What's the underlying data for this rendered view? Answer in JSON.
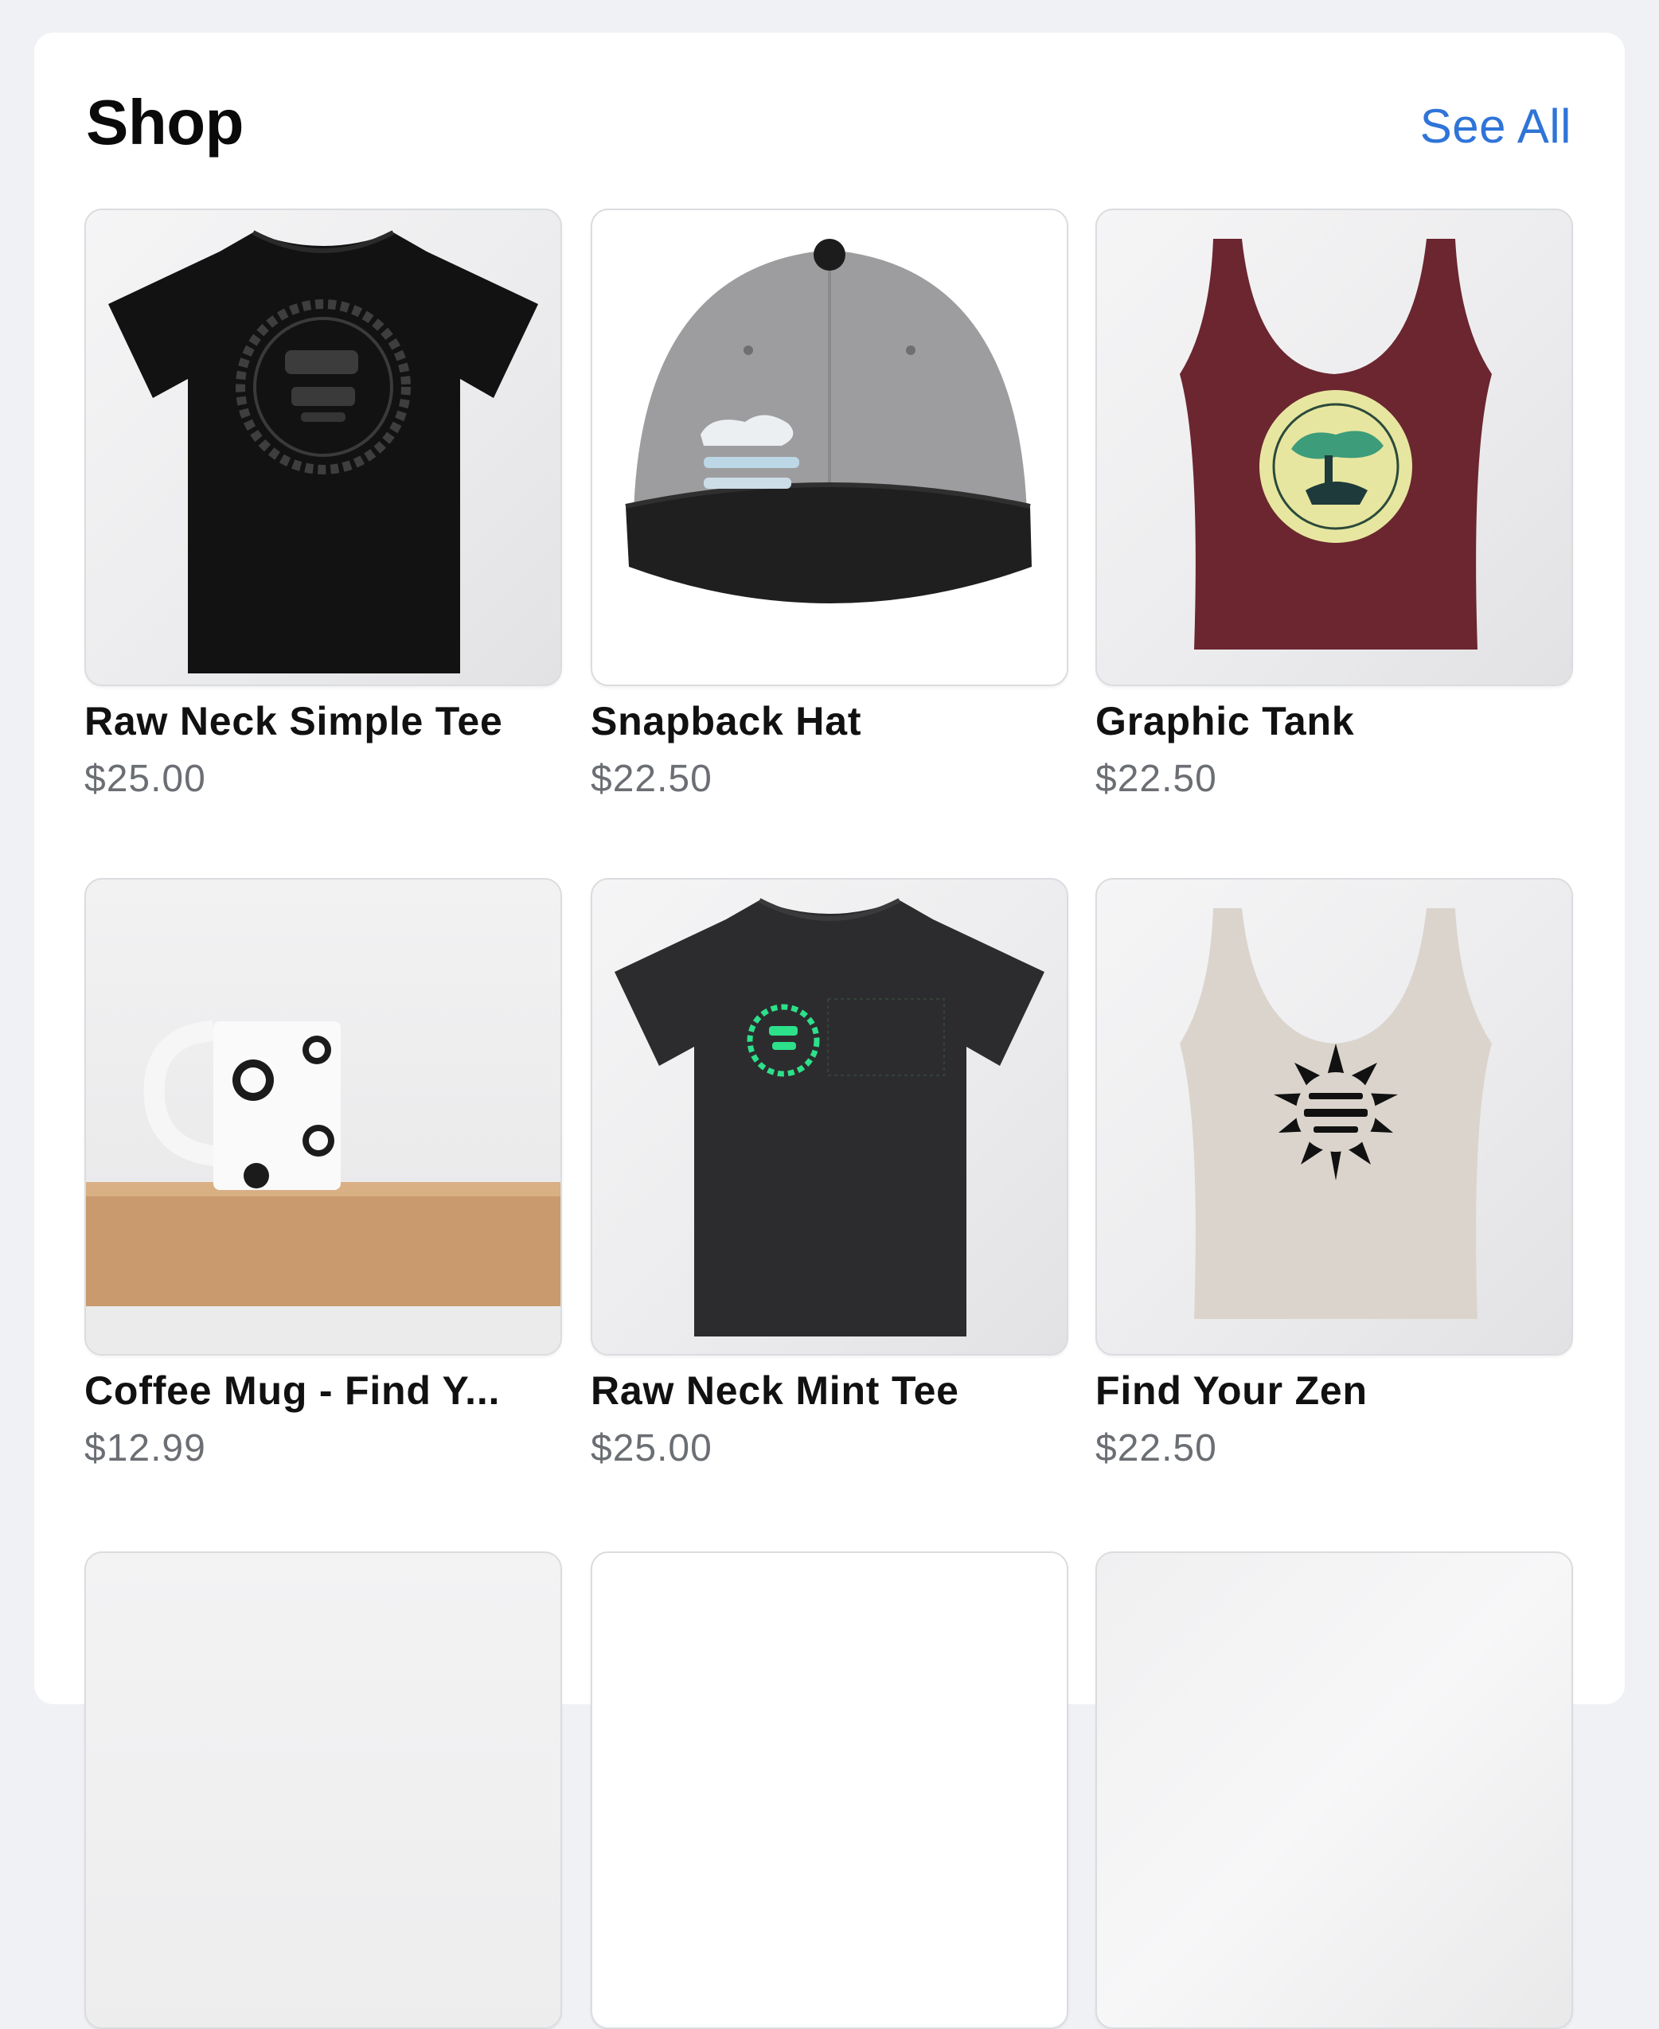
{
  "section": {
    "title": "Shop",
    "see_all": "See All"
  },
  "products": [
    {
      "name": "Raw Neck Simple Tee",
      "price": "$25.00",
      "image": "black-tshirt-bonzi-logo",
      "color": "#101010"
    },
    {
      "name": "Snapback Hat",
      "price": "$22.50",
      "image": "grey-snapback-hat",
      "color": "#9b9b9d"
    },
    {
      "name": "Graphic Tank",
      "price": "$22.50",
      "image": "maroon-tank-bonzi-logo",
      "color": "#6b2630"
    },
    {
      "name": "Coffee Mug - Find Y...",
      "price": "$12.99",
      "image": "white-mug-find-your-zen",
      "color": "#ffffff"
    },
    {
      "name": "Raw Neck Mint Tee",
      "price": "$25.00",
      "image": "charcoal-tshirt-mint-logo",
      "color": "#2c2c2e"
    },
    {
      "name": "Find Your Zen",
      "price": "$22.50",
      "image": "oatmeal-tank-find-your-zen",
      "color": "#dad4cc"
    }
  ],
  "accent": "#2f74d8"
}
